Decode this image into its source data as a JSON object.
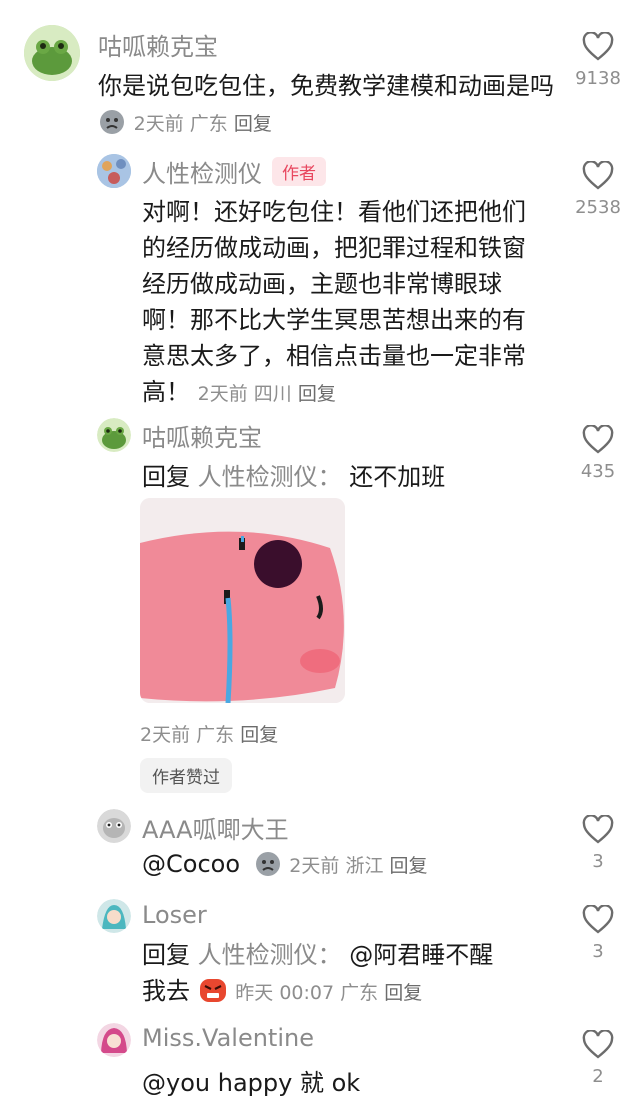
{
  "comments": [
    {
      "username": "咕呱赖克宝",
      "text": "你是说包吃包住，免费教学建模和动画是吗",
      "time": "2天前",
      "location": "广东",
      "reply_label": "回复",
      "likes": "9138"
    },
    {
      "username": "人性检测仪",
      "author_tag": "作者",
      "text": "对啊！还好吃包住！看他们还把他们的经历做成动画，把犯罪过程和铁窗经历做成动画，主题也非常博眼球啊！那不比大学生冥思苦想出来的有意思太多了，相信点击量也一定非常高！",
      "time": "2天前",
      "location": "四川",
      "reply_label": "回复",
      "likes": "2538"
    },
    {
      "username": "咕呱赖克宝",
      "reply_prefix": "回复",
      "reply_target": "人性检测仪：",
      "text": "还不加班",
      "time": "2天前",
      "location": "广东",
      "reply_label": "回复",
      "liked_by_author": "作者赞过",
      "likes": "435"
    },
    {
      "username": "AAA呱唧大王",
      "text": "@Cocoo",
      "time": "2天前",
      "location": "浙江",
      "reply_label": "回复",
      "likes": "3"
    },
    {
      "username": "Loser",
      "reply_prefix": "回复",
      "reply_target": "人性检测仪：",
      "mention": "@阿君睡不醒",
      "text": "我去",
      "time": "昨天 00:07",
      "location": "广东",
      "reply_label": "回复",
      "likes": "3"
    },
    {
      "username": "Miss.Valentine",
      "text": "@you happy 就 ok",
      "likes": "2"
    }
  ],
  "colors": {
    "username": "#8a8a8a",
    "text": "#1a1a1a",
    "author_tag_bg": "#fde6e9",
    "author_tag_text": "#e8475f",
    "mention": "#1a1a1a"
  },
  "icons": [
    "heart-outline-icon",
    "sad-face-emoji",
    "angry-face-emoji"
  ]
}
